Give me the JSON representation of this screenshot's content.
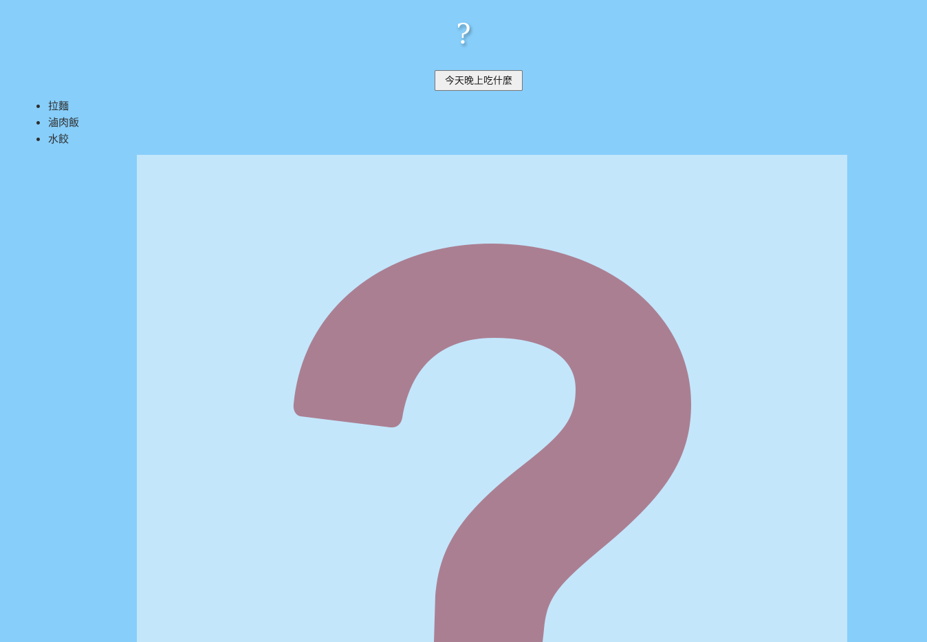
{
  "header": {
    "result_text": "?"
  },
  "controls": {
    "pick_button_label": "今天晚上吃什麼"
  },
  "menu": {
    "items": [
      {
        "label": "拉麵"
      },
      {
        "label": "滷肉飯"
      },
      {
        "label": "水餃"
      }
    ]
  },
  "image": {
    "icon": "question-mark-icon",
    "background_color": "#c3e6fb",
    "mark_color": "#ab7f92"
  }
}
